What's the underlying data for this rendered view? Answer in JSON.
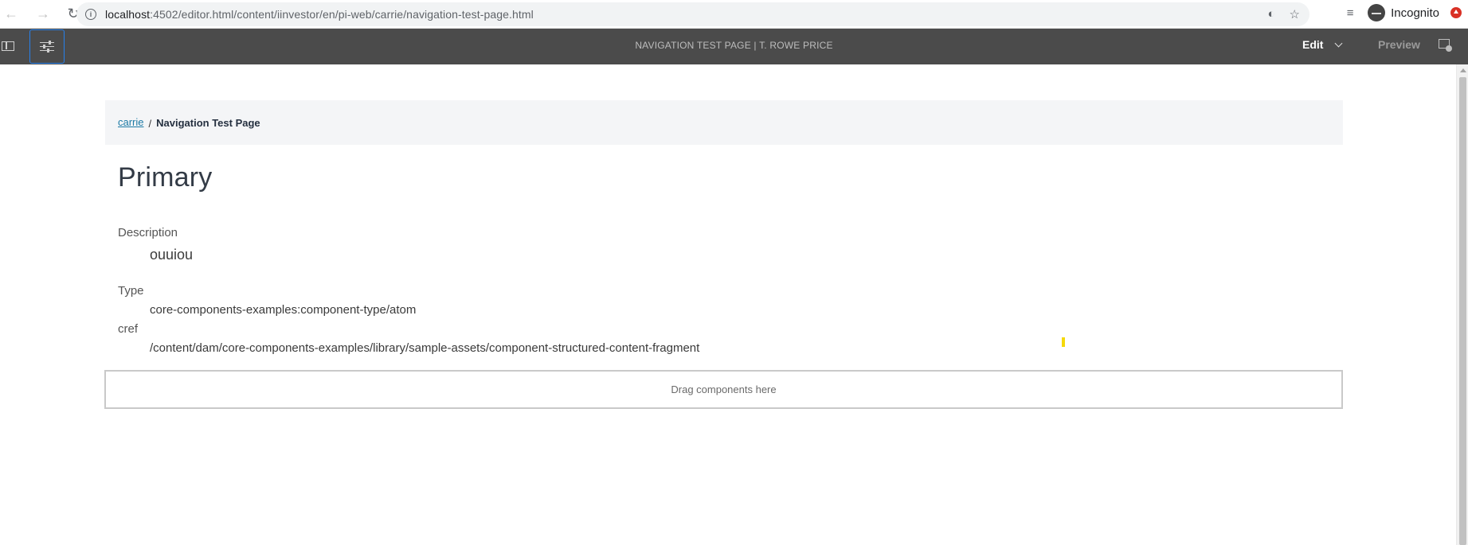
{
  "browser": {
    "url_host": "localhost",
    "url_rest": ":4502/editor.html/content/iinvestor/en/pi-web/carrie/navigation-test-page.html",
    "incognito_label": "Incognito"
  },
  "editor": {
    "title": "NAVIGATION TEST PAGE | T. ROWE PRICE",
    "mode_label": "Edit",
    "preview_label": "Preview"
  },
  "breadcrumb": {
    "parent_label": "carrie",
    "separator": "/",
    "current_label": "Navigation Test Page"
  },
  "content": {
    "heading": "Primary",
    "description_label": "Description",
    "description_value": "ouuiou",
    "type_label": "Type",
    "type_value": "core-components-examples:component-type/atom",
    "cref_label": "cref",
    "cref_value": "/content/dam/core-components-examples/library/sample-assets/component-structured-content-fragment"
  },
  "dropzone": {
    "label": "Drag components here"
  },
  "icons": [
    "back-arrow-icon",
    "forward-arrow-icon",
    "reload-icon",
    "site-info-icon",
    "eye-slash-icon",
    "star-icon",
    "tab-search-icon",
    "incognito-icon",
    "update-icon",
    "side-panel-icon",
    "page-properties-icon",
    "emulator-icon"
  ],
  "colors": {
    "editor_bar": "#4b4b4b",
    "accent_blue": "#2680eb",
    "link": "#1c7aa5",
    "breadcrumb_bg": "#f4f5f7"
  }
}
